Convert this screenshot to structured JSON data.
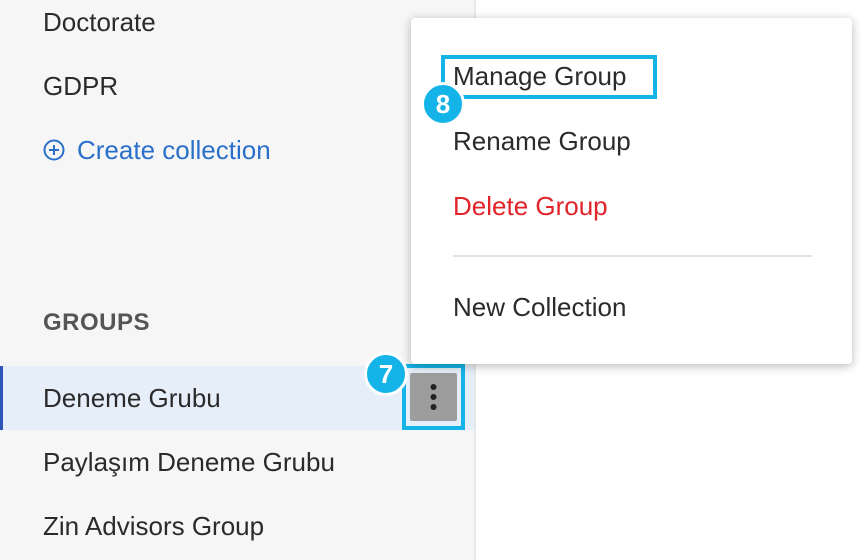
{
  "sidebar": {
    "collections": [
      {
        "label": "Doctorate"
      },
      {
        "label": "GDPR"
      }
    ],
    "create_collection_label": "Create collection",
    "groups_heading": "GROUPS",
    "groups": [
      {
        "label": "Deneme Grubu",
        "active": true
      },
      {
        "label": "Paylaşım Deneme Grubu",
        "active": false
      },
      {
        "label": "Zin Advisors Group",
        "active": false
      }
    ]
  },
  "context_menu": {
    "items": [
      {
        "label": "Manage Group"
      },
      {
        "label": "Rename Group"
      },
      {
        "label": "Delete Group",
        "style": "danger"
      },
      {
        "label": "New Collection"
      }
    ]
  },
  "annotations": {
    "step_7": "7",
    "step_8": "8"
  },
  "colors": {
    "accent": "#2a6fc9",
    "active_bg": "#e6eefa",
    "active_border": "#2b56b8",
    "highlight": "#15b4e8",
    "danger": "#e0242a",
    "sidebar_bg": "#f6f6f6"
  }
}
